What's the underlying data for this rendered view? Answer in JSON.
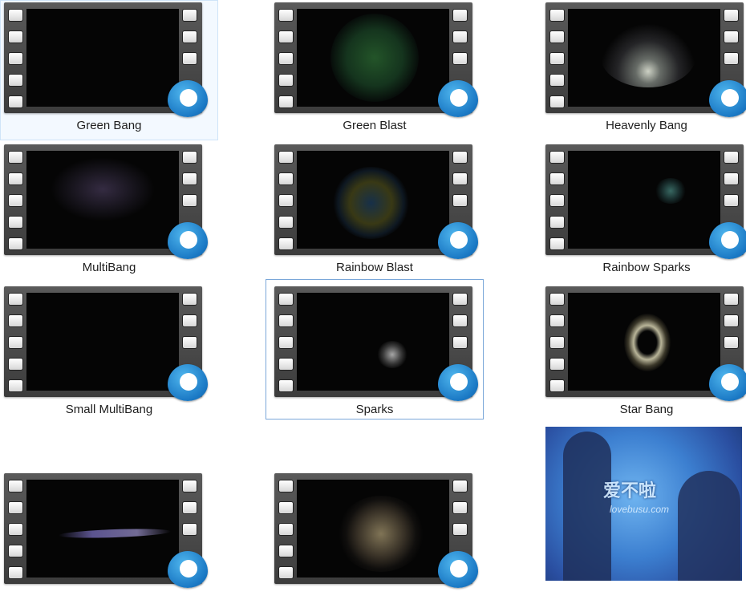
{
  "items": [
    {
      "label": "Green Bang",
      "effect": "none",
      "accent": "#000000"
    },
    {
      "label": "Green Blast",
      "effect": "sphere",
      "accent": "#2d8a3a"
    },
    {
      "label": "Heavenly Bang",
      "effect": "burst",
      "accent": "#e8f0e0"
    },
    {
      "label": "MultiBang",
      "effect": "haze",
      "accent": "#7a5a9a"
    },
    {
      "label": "Rainbow Blast",
      "effect": "sphere",
      "accent": "#3a7aa8"
    },
    {
      "label": "Rainbow Sparks",
      "effect": "small",
      "accent": "#4aa6a0"
    },
    {
      "label": "Small MultiBang",
      "effect": "none",
      "accent": "#000000"
    },
    {
      "label": "Sparks",
      "effect": "small",
      "accent": "#cfcfcf"
    },
    {
      "label": "Star Bang",
      "effect": "ring",
      "accent": "#e8e4c0"
    },
    {
      "label": "",
      "effect": "streak",
      "accent": "#7a6fc0"
    },
    {
      "label": "",
      "effect": "haze",
      "accent": "#c8b48a"
    }
  ],
  "image_item": {
    "watermark_cn": "爱不啦",
    "watermark_url": "lovebusu.com"
  }
}
